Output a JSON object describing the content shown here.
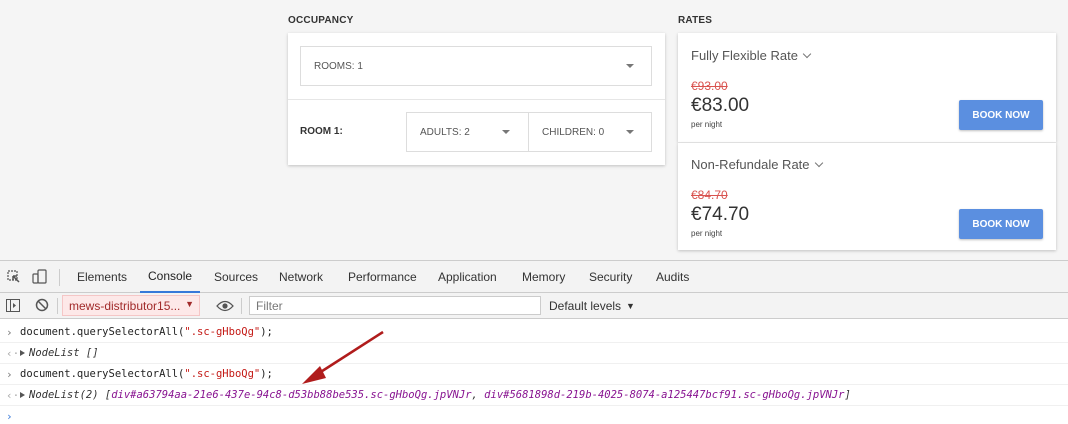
{
  "occupancy": {
    "title": "OCCUPANCY",
    "rooms_label": "ROOMS: 1",
    "room_label": "ROOM 1:",
    "adults_label": "ADULTS: 2",
    "children_label": "CHILDREN: 0"
  },
  "rates": {
    "title": "RATES",
    "items": [
      {
        "name": "Fully Flexible Rate",
        "old_price": "€93.00",
        "price": "€83.00",
        "unit": "per night",
        "button": "BOOK NOW"
      },
      {
        "name": "Non-Refundale Rate",
        "old_price": "€84.70",
        "price": "€74.70",
        "unit": "per night",
        "button": "BOOK NOW"
      }
    ]
  },
  "devtools": {
    "tabs": [
      "Elements",
      "Console",
      "Sources",
      "Network",
      "Performance",
      "Application",
      "Memory",
      "Security",
      "Audits"
    ],
    "active_tab": "Console",
    "context": "mews-distributor15...",
    "filter_placeholder": "Filter",
    "levels": "Default levels",
    "console": {
      "cmd1_prefix": "document.querySelectorAll(",
      "cmd1_arg": "\".sc-gHboQg\"",
      "cmd1_suffix": ");",
      "result1": "NodeList []",
      "cmd2_prefix": "document.querySelectorAll(",
      "cmd2_arg": "\".sc-gHboQg\"",
      "cmd2_suffix": ");",
      "result2_prefix": "NodeList(2) [",
      "result2_item1": "div#a63794aa-21e6-437e-94c8-d53bb88be535.sc-gHboQg.jpVNJr",
      "result2_sep": ", ",
      "result2_item2": "div#5681898d-219b-4025-8074-a125447bcf91.sc-gHboQg.jpVNJr",
      "result2_suffix": "]"
    }
  },
  "colors": {
    "accent": "#5b8fe0",
    "strike": "#d9534f",
    "arrow": "#b01c1c"
  }
}
